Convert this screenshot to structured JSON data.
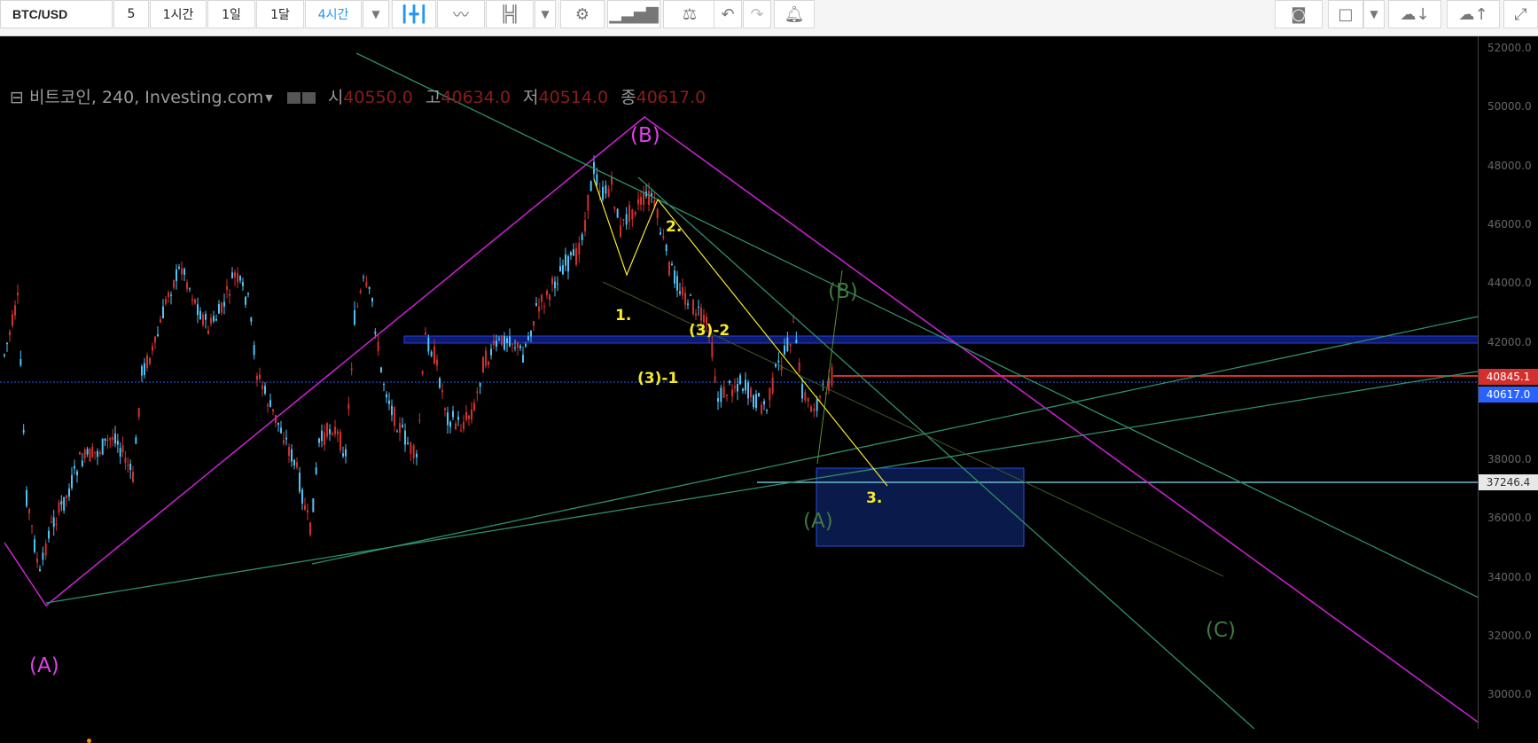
{
  "toolbar": {
    "symbol": "BTC/USD",
    "intervals": [
      "5",
      "1시간",
      "1일",
      "1달",
      "4시간"
    ],
    "active_interval": "4시간",
    "icons": [
      "dropdown-arrow-icon",
      "candlestick-icon",
      "area-chart-icon",
      "bar-chart-icon",
      "dropdown-arrow-icon",
      "settings-gear-icon",
      "indicators-icon",
      "compare-scale-icon",
      "undo-icon",
      "redo-icon",
      "alert-bell-icon",
      "camera-icon",
      "layout-square-icon",
      "dropdown-arrow-icon",
      "cloud-download-icon",
      "cloud-upload-icon",
      "fullscreen-icon"
    ]
  },
  "legend": {
    "title": "비트코인, 240, Investing.com",
    "open_label": "시",
    "open": "40550.0",
    "high_label": "고",
    "high": "40634.0",
    "low_label": "저",
    "low": "40514.0",
    "close_label": "종",
    "close": "40617.0"
  },
  "price_axis": {
    "ticks": [
      "52000.0",
      "50000.0",
      "48000.0",
      "46000.0",
      "44000.0",
      "42000.0",
      "38000.0",
      "36000.0",
      "34000.0",
      "32000.0",
      "30000.0"
    ],
    "labels": [
      {
        "text": "40845.1",
        "color": "#d32f2f"
      },
      {
        "text": "40617.0",
        "color": "#2962ff"
      },
      {
        "text": "37246.4",
        "color": "#9e9e9e"
      }
    ]
  },
  "annotations": {
    "pink_A": "(A)",
    "pink_B": "(B)",
    "green_A": "(A)",
    "green_B": "(B)",
    "green_C": "(C)",
    "y1": "1.",
    "y2": "2.",
    "y3": "3.",
    "y31": "(3)-1",
    "y32": "(3)-2"
  },
  "colors": {
    "pink": "#e040e8",
    "green": "#4caf50",
    "yellow": "#f5e92a",
    "up_candle": "#d32f2f",
    "down_candle": "#4fc3f7",
    "zone_blue": "#1a2a8c"
  }
}
